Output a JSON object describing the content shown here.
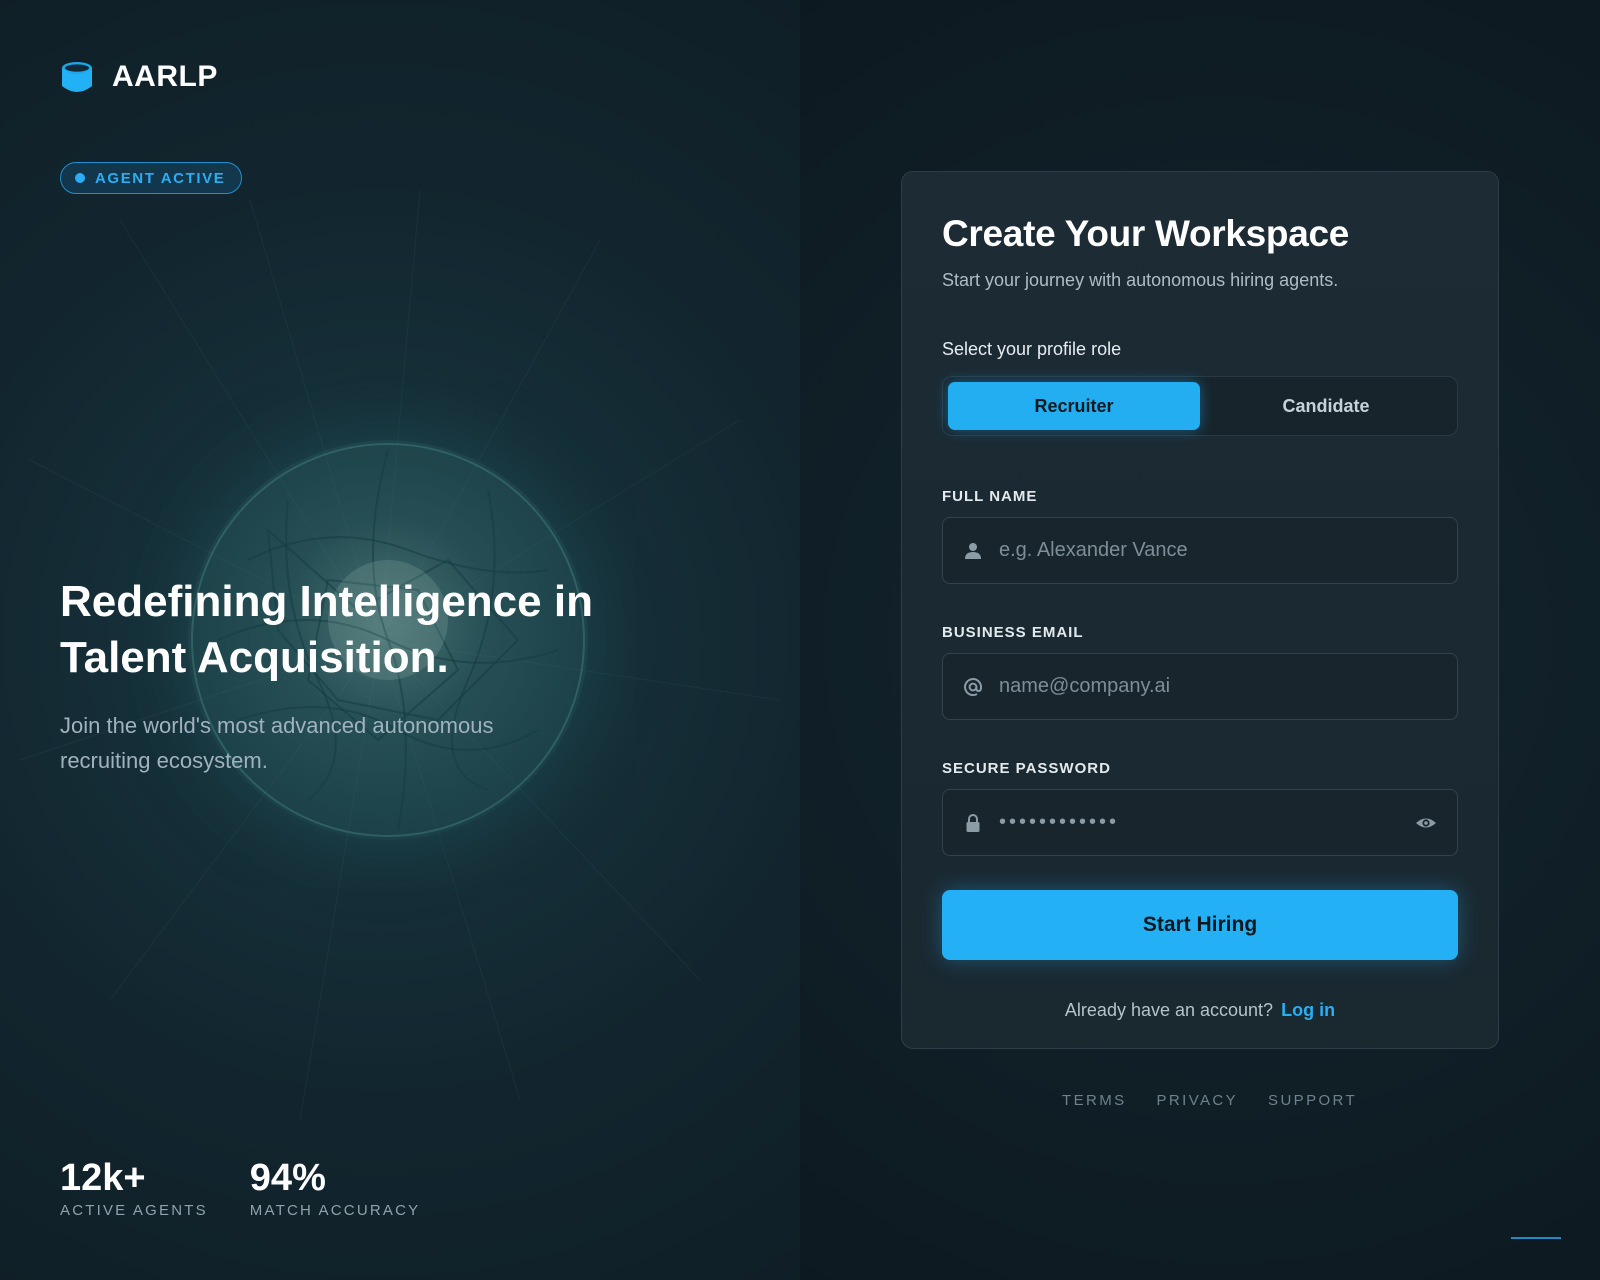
{
  "brand": {
    "name": "AARLP",
    "accent": "#24b0f5"
  },
  "status_badge": {
    "label": "AGENT ACTIVE"
  },
  "hero": {
    "title": "Redefining Intelligence in Talent Acquisition.",
    "subtitle": "Join the world's most advanced autonomous recruiting ecosystem."
  },
  "stats": [
    {
      "value": "12k+",
      "label": "ACTIVE AGENTS"
    },
    {
      "value": "94%",
      "label": "MATCH ACCURACY"
    }
  ],
  "form": {
    "title": "Create Your Workspace",
    "subtitle": "Start your journey with autonomous hiring agents.",
    "role_label": "Select your profile role",
    "roles": [
      {
        "label": "Recruiter",
        "selected": true
      },
      {
        "label": "Candidate",
        "selected": false
      }
    ],
    "full_name": {
      "label": "FULL NAME",
      "placeholder": "e.g. Alexander Vance",
      "value": "",
      "icon": "user-icon"
    },
    "email": {
      "label": "BUSINESS EMAIL",
      "placeholder": "name@company.ai",
      "value": "",
      "icon": "at-icon"
    },
    "password": {
      "label": "SECURE PASSWORD",
      "masked_value": "••••••••••••",
      "icon": "lock-icon",
      "toggle_icon": "eye-icon"
    },
    "submit_label": "Start Hiring",
    "login_prompt": "Already have an account?",
    "login_link": "Log in"
  },
  "footer": {
    "links": [
      "TERMS",
      "PRIVACY",
      "SUPPORT"
    ]
  }
}
